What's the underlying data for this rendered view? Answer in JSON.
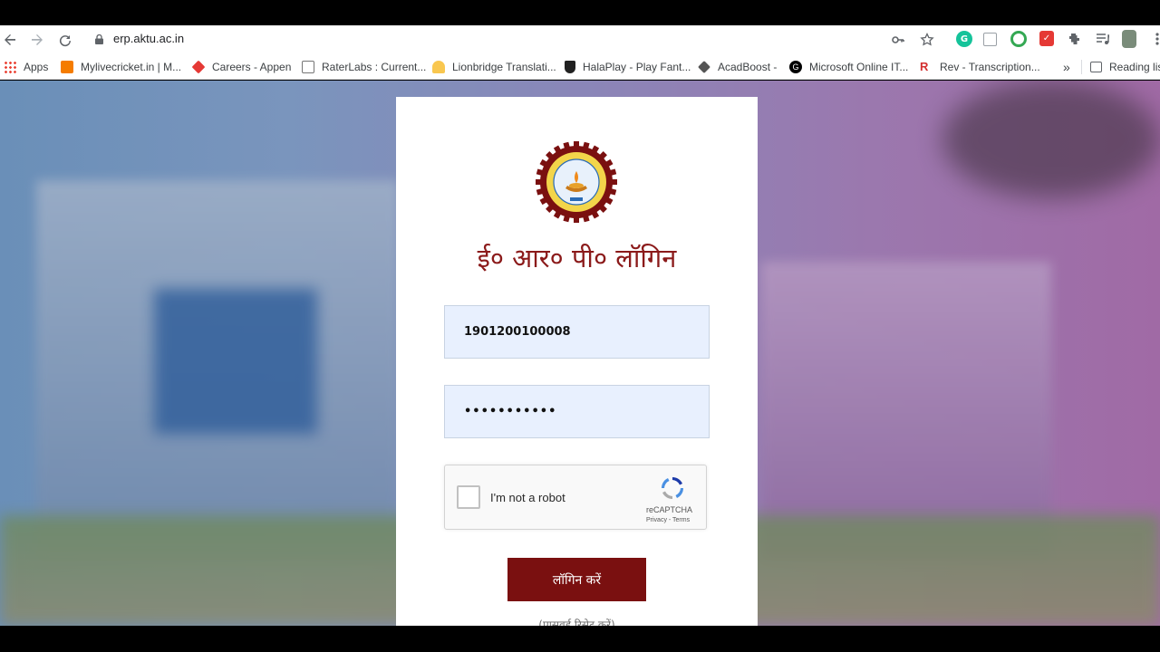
{
  "browser": {
    "url_host": "erp.aktu.ac.in",
    "bookmarks": [
      {
        "label": "Apps",
        "icon": "apps-grid-icon",
        "color": "#ea4335"
      },
      {
        "label": "Mylivecricket.in | M...",
        "icon": "blogger-icon",
        "color": "#f57c00"
      },
      {
        "label": "Careers - Appen",
        "icon": "appen-icon",
        "color": "#e53935"
      },
      {
        "label": "RaterLabs : Current...",
        "icon": "raterlabs-icon",
        "color": "#757575"
      },
      {
        "label": "Lionbridge Translati...",
        "icon": "lionbridge-icon",
        "color": "#f9a825"
      },
      {
        "label": "HalaPlay - Play Fant...",
        "icon": "halaplay-icon",
        "color": "#212121"
      },
      {
        "label": "AcadBoost -",
        "icon": "acadboost-icon",
        "color": "#424242"
      },
      {
        "label": "Microsoft Online IT...",
        "icon": "microsoft-g-icon",
        "color": "#000000"
      },
      {
        "label": "Rev - Transcription...",
        "icon": "rev-icon",
        "color": "#d32f2f"
      }
    ],
    "more_bookmarks": "»",
    "reading_list": "Reading list"
  },
  "login": {
    "title": "ई० आर० पी० लॉगिन",
    "username_value": "1901200100008",
    "password_value": "•••••••••••",
    "captcha_label": "I'm not a robot",
    "captcha_brand": "reCAPTCHA",
    "captcha_terms": "Privacy - Terms",
    "login_button": "लॉगिन करें",
    "reset_password": "(पासवर्ड रिसेट करें)"
  },
  "colors": {
    "brand_maroon": "#7a1010",
    "title_color": "#8b1a1a",
    "input_bg": "#e8f0fe"
  }
}
